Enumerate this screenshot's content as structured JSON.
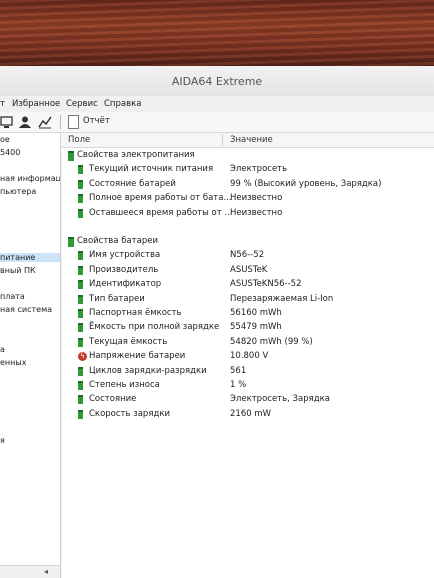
{
  "window": {
    "title": "AIDA64 Extreme"
  },
  "menu": [
    "т",
    "Избранное",
    "Сервис",
    "Справка"
  ],
  "toolbar": {
    "report_label": "Отчёт"
  },
  "tree": {
    "items": [
      "ое",
      "5400",
      "",
      "ная информац",
      "пьютера",
      "",
      "",
      "",
      "",
      "питание",
      "вный ПК",
      "",
      "плата",
      "ная система",
      "",
      "",
      "а",
      "енных",
      "",
      "",
      "",
      "",
      "",
      "я",
      "",
      "",
      "",
      "",
      "",
      "",
      ""
    ],
    "selected_index": 9
  },
  "columns": {
    "field": "Поле",
    "value": "Значение"
  },
  "sections": [
    {
      "title": "Свойства электропитания",
      "rows": [
        {
          "field": "Текущий источник питания",
          "value": "Электросеть",
          "icon": "battery-icon"
        },
        {
          "field": "Состояние батарей",
          "value": "99 % (Высокий уровень, Зарядка)",
          "icon": "battery-icon"
        },
        {
          "field": "Полное время работы от бата...",
          "value": "Неизвестно",
          "icon": "battery-icon"
        },
        {
          "field": "Оставшееся время работы от ...",
          "value": "Неизвестно",
          "icon": "battery-icon"
        }
      ]
    },
    {
      "title": "Свойства батареи",
      "rows": [
        {
          "field": "Имя устройства",
          "value": "N56--52",
          "icon": "battery-icon"
        },
        {
          "field": "Производитель",
          "value": "ASUSTeK",
          "icon": "battery-icon"
        },
        {
          "field": "Идентификатор",
          "value": "ASUSTeKN56--52",
          "icon": "battery-icon"
        },
        {
          "field": "Тип батареи",
          "value": "Перезаряжаемая Li-Ion",
          "icon": "battery-icon"
        },
        {
          "field": "Паспортная ёмкость",
          "value": "56160 mWh",
          "icon": "battery-icon"
        },
        {
          "field": "Ёмкость при полной зарядке",
          "value": "55479 mWh",
          "icon": "battery-icon"
        },
        {
          "field": "Текущая ёмкость",
          "value": "54820 mWh  (99 %)",
          "icon": "battery-icon"
        },
        {
          "field": "Напряжение батареи",
          "value": "10.800 V",
          "icon": "voltage-icon"
        },
        {
          "field": "Циклов зарядки-разрядки",
          "value": "561",
          "icon": "battery-icon"
        },
        {
          "field": "Степень износа",
          "value": "1 %",
          "icon": "battery-icon"
        },
        {
          "field": "Состояние",
          "value": "Электросеть, Зарядка",
          "icon": "battery-icon"
        },
        {
          "field": "Скорость зарядки",
          "value": "2160 mW",
          "icon": "battery-icon"
        }
      ]
    }
  ],
  "colors": {
    "battery": "#2e9a35",
    "voltage": "#c9392d",
    "selection": "#cde3f7"
  }
}
